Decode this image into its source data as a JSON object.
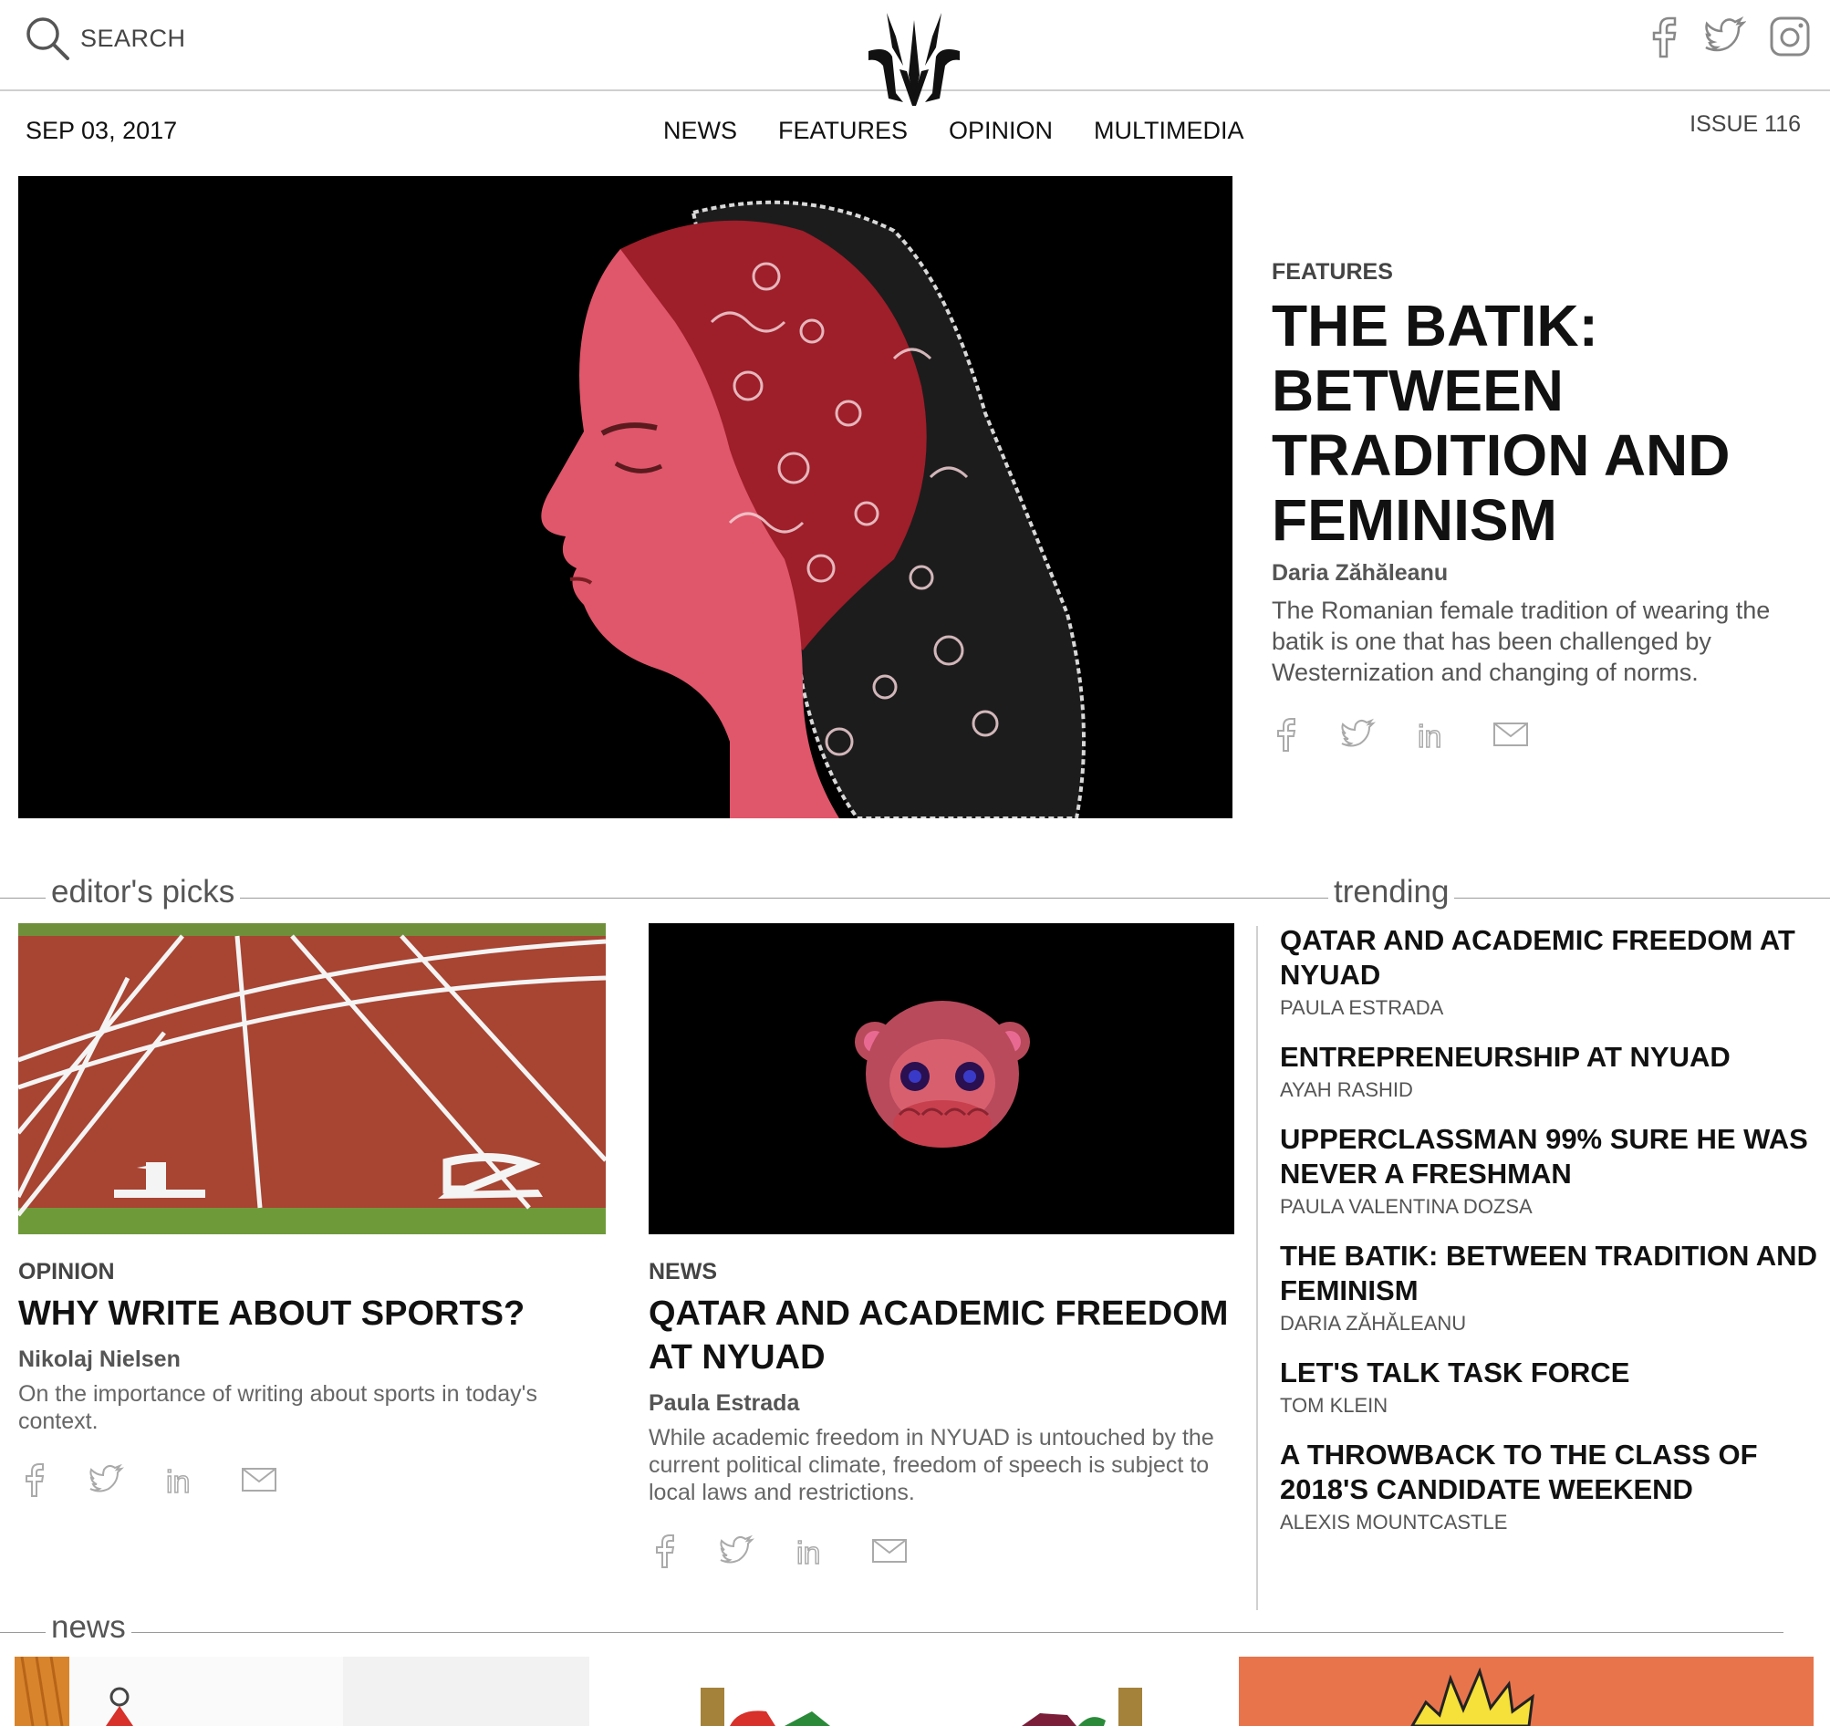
{
  "header": {
    "search_label": "SEARCH",
    "social_icons": [
      "facebook-icon",
      "twitter-icon",
      "instagram-icon"
    ]
  },
  "subheader": {
    "date": "SEP 03, 2017",
    "nav": [
      "NEWS",
      "FEATURES",
      "OPINION",
      "MULTIMEDIA"
    ],
    "issue": "ISSUE 116"
  },
  "hero": {
    "category": "FEATURES",
    "title": "THE BATIK: BETWEEN TRADITION AND FEMINISM",
    "author": "Daria Zăhăleanu",
    "description": "The Romanian female tradition of wearing the batik is one that has been challenged by Westernization and changing of norms.",
    "share_icons": [
      "facebook-icon",
      "twitter-icon",
      "linkedin-icon",
      "email-icon"
    ]
  },
  "sections": {
    "editors_picks": "editor's picks",
    "trending": "trending",
    "news": "news"
  },
  "picks": [
    {
      "category": "OPINION",
      "title": "WHY WRITE ABOUT SPORTS?",
      "author": "Nikolaj Nielsen",
      "description": "On the importance of writing about sports in today's context."
    },
    {
      "category": "NEWS",
      "title": "QATAR AND ACADEMIC FREEDOM AT NYUAD",
      "author": "Paula Estrada",
      "description": "While academic freedom in NYUAD is untouched by the current political climate, freedom of speech is subject to local laws and restrictions."
    }
  ],
  "trending": [
    {
      "title": "QATAR AND ACADEMIC FREEDOM AT NYUAD",
      "author": "PAULA ESTRADA"
    },
    {
      "title": "ENTREPRENEURSHIP AT NYUAD",
      "author": "AYAH RASHID"
    },
    {
      "title": "UPPERCLASSMAN 99% SURE HE WAS NEVER A FRESHMAN",
      "author": "PAULA VALENTINA DOZSA"
    },
    {
      "title": "THE BATIK: BETWEEN TRADITION AND FEMINISM",
      "author": "DARIA ZĂHĂLEANU"
    },
    {
      "title": "LET'S TALK TASK FORCE",
      "author": "TOM KLEIN"
    },
    {
      "title": "A THROWBACK TO THE CLASS OF 2018'S CANDIDATE WEEKEND",
      "author": "ALEXIS MOUNTCASTLE"
    }
  ],
  "colors": {
    "hero_background": "#000000",
    "face": "#e0566a",
    "track": "#a84432",
    "news_orange": "#e8744c"
  }
}
